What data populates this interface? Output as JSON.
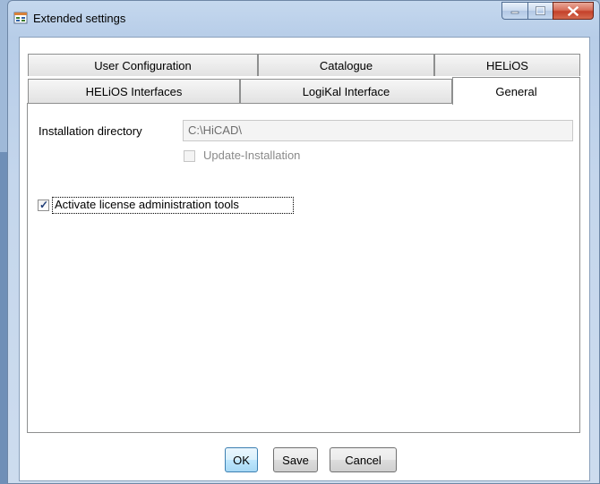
{
  "window": {
    "title": "Extended settings",
    "icon": "settings-app-icon",
    "controls": {
      "minimize": "minimize-icon",
      "maximize": "maximize-icon",
      "close": "close-icon"
    }
  },
  "tabs": {
    "row_back": [
      "User Configuration",
      "Catalogue",
      "HELiOS"
    ],
    "row_front": [
      "HELiOS Interfaces",
      "LogiKal Interface",
      "General"
    ],
    "selected": "General"
  },
  "general": {
    "install_dir_label": "Installation directory",
    "install_dir_value": "C:\\HiCAD\\",
    "update_install_label": "Update-Installation",
    "update_install_checked": false,
    "update_install_enabled": false,
    "license_tools_label": "Activate license administration tools",
    "license_tools_checked": true
  },
  "buttons": {
    "ok": "OK",
    "save": "Save",
    "cancel": "Cancel"
  },
  "colors": {
    "accent": "#3c7fb1",
    "close_red": "#c4412a"
  }
}
